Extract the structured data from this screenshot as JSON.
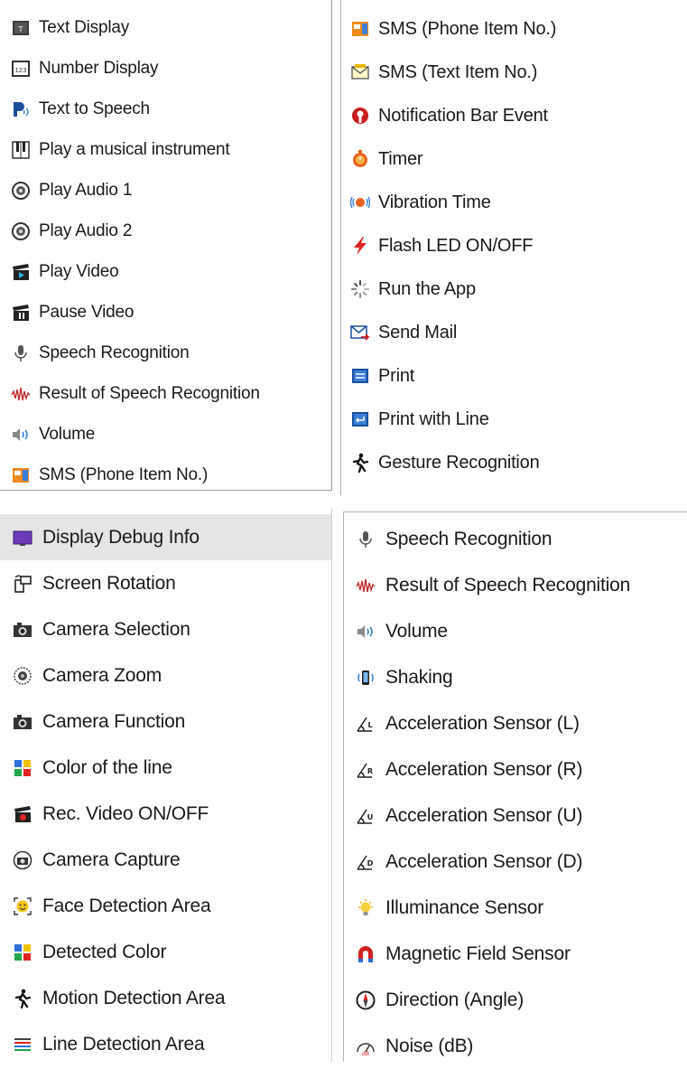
{
  "panel_top_left": {
    "items": [
      {
        "label": "Text Display",
        "icon": "text-display-icon"
      },
      {
        "label": "Number Display",
        "icon": "number-display-icon"
      },
      {
        "label": "Text to Speech",
        "icon": "text-to-speech-icon"
      },
      {
        "label": "Play a musical instrument",
        "icon": "piano-icon"
      },
      {
        "label": "Play Audio 1",
        "icon": "speaker-icon"
      },
      {
        "label": "Play Audio 2",
        "icon": "speaker-icon"
      },
      {
        "label": "Play Video",
        "icon": "clapperboard-play-icon"
      },
      {
        "label": "Pause Video",
        "icon": "clapperboard-pause-icon"
      },
      {
        "label": "Speech Recognition",
        "icon": "microphone-icon"
      },
      {
        "label": "Result of Speech Recognition",
        "icon": "waveform-icon"
      },
      {
        "label": "Volume",
        "icon": "volume-icon"
      },
      {
        "label": "SMS (Phone Item No.)",
        "icon": "sms-phone-icon"
      }
    ]
  },
  "panel_top_right": {
    "items": [
      {
        "label": "SMS (Phone Item No.)",
        "icon": "sms-phone-icon"
      },
      {
        "label": "SMS (Text Item No.)",
        "icon": "envelope-icon"
      },
      {
        "label": "Notification Bar Event",
        "icon": "notification-icon"
      },
      {
        "label": "Timer",
        "icon": "timer-icon"
      },
      {
        "label": "Vibration Time",
        "icon": "vibration-icon"
      },
      {
        "label": "Flash LED ON/OFF",
        "icon": "flash-icon"
      },
      {
        "label": "Run the App",
        "icon": "spinner-icon"
      },
      {
        "label": "Send Mail",
        "icon": "send-mail-icon"
      },
      {
        "label": "Print",
        "icon": "print-icon"
      },
      {
        "label": "Print with Line",
        "icon": "print-line-icon"
      },
      {
        "label": "Gesture Recognition",
        "icon": "gesture-icon"
      }
    ]
  },
  "panel_bottom_left": {
    "selected_index": 0,
    "items": [
      {
        "label": "Display Debug Info",
        "icon": "monitor-icon"
      },
      {
        "label": "Screen Rotation",
        "icon": "rotation-icon"
      },
      {
        "label": "Camera Selection",
        "icon": "camera-icon"
      },
      {
        "label": "Camera Zoom",
        "icon": "zoom-icon"
      },
      {
        "label": "Camera Function",
        "icon": "camera-icon"
      },
      {
        "label": "Color of the line",
        "icon": "color-grid-icon"
      },
      {
        "label": "Rec. Video ON/OFF",
        "icon": "rec-video-icon"
      },
      {
        "label": "Camera Capture",
        "icon": "capture-icon"
      },
      {
        "label": "Face Detection Area",
        "icon": "face-icon"
      },
      {
        "label": "Detected Color",
        "icon": "color-grid-icon"
      },
      {
        "label": "Motion Detection Area",
        "icon": "motion-icon"
      },
      {
        "label": "Line Detection Area",
        "icon": "lines-icon"
      }
    ]
  },
  "panel_bottom_right": {
    "items": [
      {
        "label": "Speech Recognition",
        "icon": "microphone-icon"
      },
      {
        "label": "Result of Speech Recognition",
        "icon": "waveform-icon"
      },
      {
        "label": "Volume",
        "icon": "volume-icon"
      },
      {
        "label": "Shaking",
        "icon": "shaking-icon"
      },
      {
        "label": "Acceleration Sensor (L)",
        "icon": "accel-l-icon"
      },
      {
        "label": "Acceleration Sensor (R)",
        "icon": "accel-r-icon"
      },
      {
        "label": "Acceleration Sensor (U)",
        "icon": "accel-u-icon"
      },
      {
        "label": "Acceleration Sensor (D)",
        "icon": "accel-d-icon"
      },
      {
        "label": "Illuminance Sensor",
        "icon": "bulb-icon"
      },
      {
        "label": "Magnetic Field Sensor",
        "icon": "magnet-icon"
      },
      {
        "label": "Direction (Angle)",
        "icon": "compass-icon"
      },
      {
        "label": "Noise (dB)",
        "icon": "noise-icon"
      }
    ]
  }
}
